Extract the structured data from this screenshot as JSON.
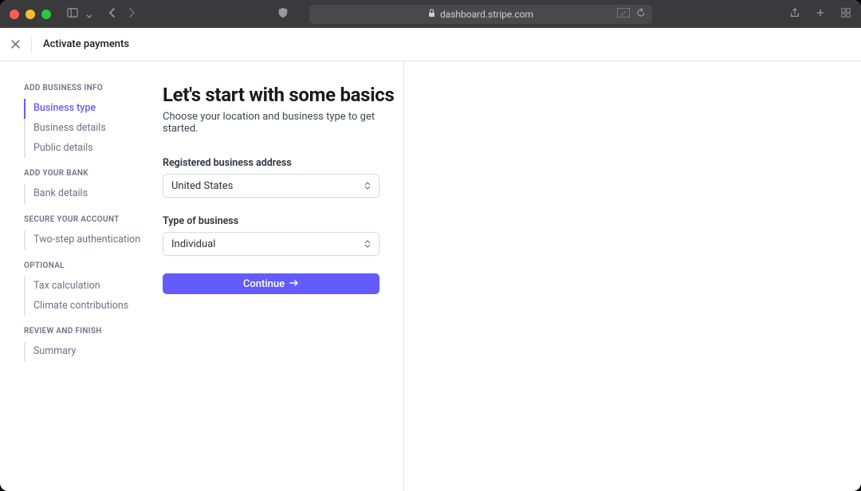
{
  "browser": {
    "url": "dashboard.stripe.com"
  },
  "header": {
    "title": "Activate payments"
  },
  "sidebar": {
    "sections": [
      {
        "label": "ADD BUSINESS INFO",
        "items": [
          {
            "label": "Business type",
            "active": true
          },
          {
            "label": "Business details"
          },
          {
            "label": "Public details"
          }
        ]
      },
      {
        "label": "ADD YOUR BANK",
        "items": [
          {
            "label": "Bank details"
          }
        ]
      },
      {
        "label": "SECURE YOUR ACCOUNT",
        "items": [
          {
            "label": "Two-step authentication"
          }
        ]
      },
      {
        "label": "OPTIONAL",
        "items": [
          {
            "label": "Tax calculation"
          },
          {
            "label": "Climate contributions"
          }
        ]
      },
      {
        "label": "REVIEW AND FINISH",
        "items": [
          {
            "label": "Summary"
          }
        ]
      }
    ]
  },
  "main": {
    "title": "Let's start with some basics",
    "subtitle": "Choose your location and business type to get started.",
    "fields": {
      "address": {
        "label": "Registered business address",
        "value": "United States"
      },
      "business_type": {
        "label": "Type of business",
        "value": "Individual"
      }
    },
    "continue_label": "Continue"
  }
}
